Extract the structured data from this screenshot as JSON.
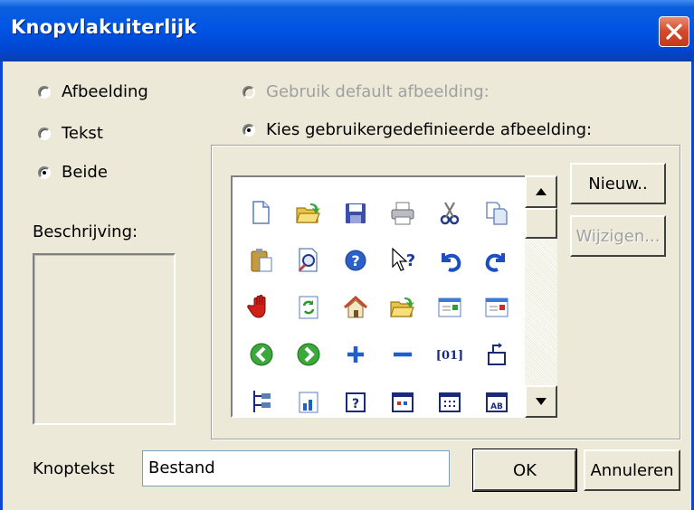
{
  "window": {
    "title": "Knopvlakuiterlijk"
  },
  "display_options": [
    {
      "label": "Afbeelding",
      "checked": false
    },
    {
      "label": "Tekst",
      "checked": false
    },
    {
      "label": "Beide",
      "checked": true
    }
  ],
  "image_source": {
    "default_label": "Gebruik default afbeelding:",
    "custom_label": "Kies gebruikergedefinieerde afbeelding:"
  },
  "description": {
    "label": "Beschrijving:"
  },
  "icons": [
    "new-document-icon",
    "open-folder-icon",
    "save-disk-icon",
    "print-icon",
    "cut-scissors-icon",
    "copy-icon",
    "paste-clipboard-icon",
    "print-preview-icon",
    "help-icon",
    "context-help-icon",
    "undo-icon",
    "redo-icon",
    "stop-hand-icon",
    "refresh-icon",
    "home-icon",
    "open-folder-icon",
    "window-green-icon",
    "window-red-icon",
    "back-arrow-icon",
    "forward-arrow-icon",
    "plus-icon",
    "minus-icon",
    "binary-icon",
    "export-icon",
    "tree-icon",
    "document-chart-icon",
    "help-box-icon",
    "form-icon",
    "grid-icon",
    "text-field-icon"
  ],
  "buttons": {
    "new": "Nieuw..",
    "modify": "Wijzigen...",
    "ok": "OK",
    "cancel": "Annuleren"
  },
  "button_text": {
    "label": "Knoptekst",
    "value": "Bestand"
  }
}
